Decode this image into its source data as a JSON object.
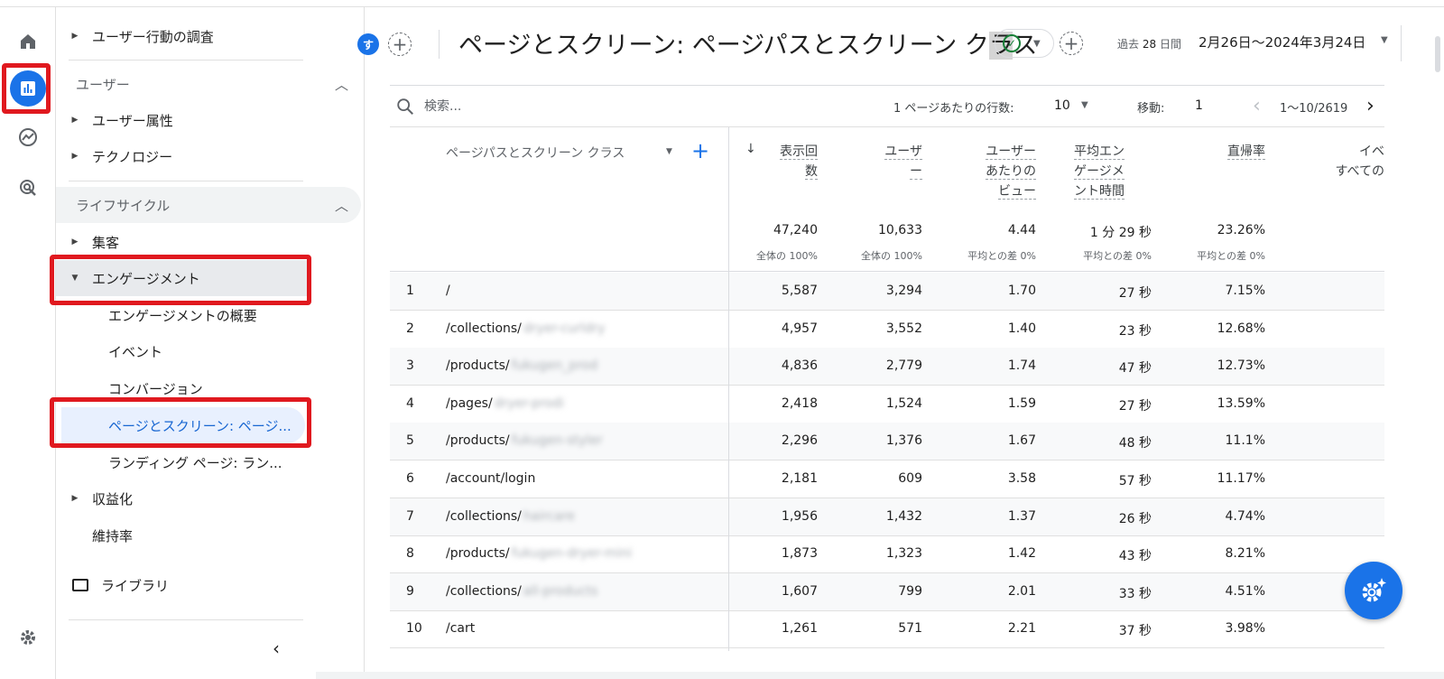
{
  "colors": {
    "accent": "#1a73e8",
    "highlight_box": "#e0191f",
    "selected_bg": "#e8f0fe"
  },
  "rail": {
    "icons": [
      "home-icon",
      "reports-icon",
      "explore-icon",
      "advertising-icon",
      "settings-icon"
    ]
  },
  "nav": {
    "user_behavior": "ユーザー行動の調査",
    "section_user": "ユーザー",
    "user_attributes": "ユーザー属性",
    "technology": "テクノロジー",
    "section_lifecycle": "ライフサイクル",
    "acquisition": "集客",
    "engagement": "エンゲージメント",
    "engagement_overview": "エンゲージメントの概要",
    "events": "イベント",
    "conversions": "コンバージョン",
    "pages_screens": "ページとスクリーン: ページ...",
    "landing_page": "ランディング ページ: ラン...",
    "monetization": "収益化",
    "retention": "維持率",
    "library": "ライブラリ"
  },
  "header": {
    "chip": "す",
    "title_main": "ページとスクリーン: ページパスとスクリーン ク",
    "title_hl": "ラ",
    "title_end": "ス",
    "date_label": "過去",
    "date_days": "28",
    "date_unit": "日間",
    "date_range": "2月26日～2024年3月24日"
  },
  "toolbar": {
    "search_placeholder": "検索...",
    "rows_label": "1 ページあたりの行数:",
    "rows_value": "10",
    "goto_label": "移動:",
    "goto_value": "1",
    "range": "1～10/2619"
  },
  "table": {
    "dimension_header": "ページパスとスクリーン クラス",
    "headers": {
      "views_1": "表示回",
      "views_2": "数",
      "users_1": "ユーザ",
      "users_2": "ー",
      "vpu_1": "ユーザー",
      "vpu_2": "あたりの",
      "vpu_3": "ビュー",
      "eng_1": "平均エン",
      "eng_2": "ゲージメ",
      "eng_3": "ント時間",
      "bounce": "直帰率",
      "event_1": "イベ",
      "event_2": "すべての"
    },
    "totals": {
      "views": "47,240",
      "views_sub": "全体の 100%",
      "users": "10,633",
      "users_sub": "全体の 100%",
      "vpu": "4.44",
      "vpu_sub": "平均との差 0%",
      "eng": "1 分 29 秒",
      "eng_sub": "平均との差 0%",
      "bounce": "23.26%",
      "bounce_sub": "平均との差 0%"
    },
    "rows": [
      {
        "n": "1",
        "path": "/",
        "blur": "",
        "views": "5,587",
        "users": "3,294",
        "vpu": "1.70",
        "eng": "27 秒",
        "bounce": "7.15%"
      },
      {
        "n": "2",
        "path": "/collections/",
        "blur": "dryer-curldry",
        "views": "4,957",
        "users": "3,552",
        "vpu": "1.40",
        "eng": "23 秒",
        "bounce": "12.68%"
      },
      {
        "n": "3",
        "path": "/products/",
        "blur": "fukugen_prod",
        "views": "4,836",
        "users": "2,779",
        "vpu": "1.74",
        "eng": "47 秒",
        "bounce": "12.73%"
      },
      {
        "n": "4",
        "path": "/pages/",
        "blur": "dryer-prodi",
        "views": "2,418",
        "users": "1,524",
        "vpu": "1.59",
        "eng": "27 秒",
        "bounce": "13.59%"
      },
      {
        "n": "5",
        "path": "/products/",
        "blur": "fukugen-styler",
        "views": "2,296",
        "users": "1,376",
        "vpu": "1.67",
        "eng": "48 秒",
        "bounce": "11.1%"
      },
      {
        "n": "6",
        "path": "/account/login",
        "blur": "",
        "views": "2,181",
        "users": "609",
        "vpu": "3.58",
        "eng": "57 秒",
        "bounce": "11.17%"
      },
      {
        "n": "7",
        "path": "/collections/",
        "blur": "haircare",
        "views": "1,956",
        "users": "1,432",
        "vpu": "1.37",
        "eng": "26 秒",
        "bounce": "4.74%"
      },
      {
        "n": "8",
        "path": "/products/",
        "blur": "fukugen-dryer-mini",
        "views": "1,873",
        "users": "1,323",
        "vpu": "1.42",
        "eng": "43 秒",
        "bounce": "8.21%"
      },
      {
        "n": "9",
        "path": "/collections/",
        "blur": "all-products",
        "views": "1,607",
        "users": "799",
        "vpu": "2.01",
        "eng": "33 秒",
        "bounce": "4.51%"
      },
      {
        "n": "10",
        "path": "/cart",
        "blur": "",
        "views": "1,261",
        "users": "571",
        "vpu": "2.21",
        "eng": "37 秒",
        "bounce": "3.98%"
      }
    ]
  }
}
